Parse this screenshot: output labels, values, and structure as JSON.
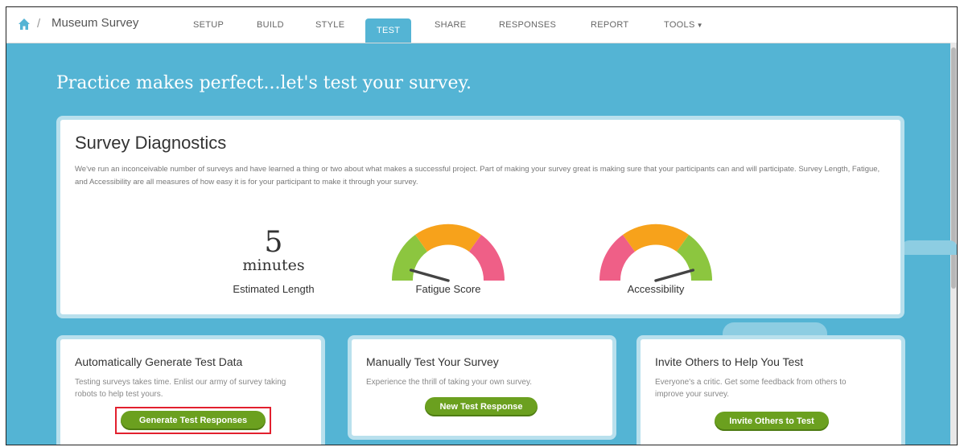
{
  "breadcrumb": {
    "survey_name": "Museum Survey",
    "separator": "/"
  },
  "nav": {
    "tabs": [
      "SETUP",
      "BUILD",
      "STYLE",
      "TEST",
      "SHARE",
      "RESPONSES",
      "REPORT",
      "TOOLS"
    ],
    "active": "TEST"
  },
  "headline": "Practice makes perfect...let's test your survey.",
  "diagnostics": {
    "title": "Survey Diagnostics",
    "description": "We've run an inconceivable number of surveys and have learned a thing or two about what makes a successful project. Part of making your survey great is making sure that your participants can and will participate. Survey Length, Fatigue, and Accessibility are all measures of how easy it is for your participant to make it through your survey.",
    "length_value": "5",
    "length_unit": "minutes",
    "length_label": "Estimated Length",
    "fatigue_label": "Fatigue Score",
    "accessibility_label": "Accessibility",
    "fatigue_level": 0.15,
    "accessibility_level": 0.85
  },
  "cards": {
    "auto": {
      "title": "Automatically Generate Test Data",
      "desc": "Testing surveys takes time. Enlist our army of survey taking robots to help test yours.",
      "button": "Generate Test Responses"
    },
    "manual": {
      "title": "Manually Test Your Survey",
      "desc": "Experience the thrill of taking your own survey.",
      "button": "New Test Response"
    },
    "invite": {
      "title": "Invite Others to Help You Test",
      "desc": "Everyone's a critic. Get some feedback from others to improve your survey.",
      "button": "Invite Others to Test"
    }
  },
  "colors": {
    "background": "#54b4d4",
    "button": "#6ba01f",
    "gauge_green": "#8cc63f",
    "gauge_orange": "#f7a21b",
    "gauge_pink": "#ef5f87",
    "highlight": "#e2202e"
  }
}
